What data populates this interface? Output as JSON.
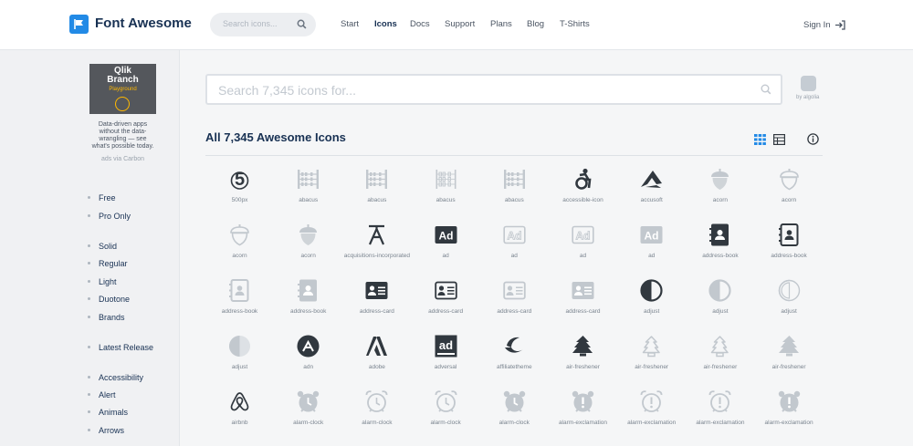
{
  "header": {
    "brand": "Font Awesome",
    "search_placeholder": "Search icons...",
    "nav": [
      {
        "label": "Start",
        "active": false
      },
      {
        "label": "Icons",
        "active": true
      },
      {
        "label": "Docs",
        "active": false
      },
      {
        "label": "Support",
        "active": false
      },
      {
        "label": "Plans",
        "active": false
      },
      {
        "label": "Blog",
        "active": false
      },
      {
        "label": "T-Shirts",
        "active": false
      }
    ],
    "signin": "Sign In"
  },
  "ad": {
    "title_line1": "Qlik",
    "title_line2": "Branch",
    "subtitle": "Playground",
    "text_lines": [
      "Data-driven apps",
      "without the data-",
      "wrangling — see",
      "what's possible today."
    ],
    "via": "ads via Carbon"
  },
  "sidebar": {
    "groups": [
      [
        "Free",
        "Pro Only"
      ],
      [
        "Solid",
        "Regular",
        "Light",
        "Duotone",
        "Brands"
      ],
      [
        "Latest Release"
      ],
      [
        "Accessibility",
        "Alert",
        "Animals",
        "Arrows"
      ]
    ]
  },
  "search": {
    "placeholder": "Search 7,345 icons for...",
    "powered_by": "by algolia"
  },
  "results": {
    "title": "All 7,345 Awesome Icons"
  },
  "colors": {
    "dark": "#31383f",
    "light": "#c2c8ce",
    "accent": "#228ae6"
  },
  "icons": [
    {
      "name": "500px",
      "glyph": "500px",
      "tone": "dark"
    },
    {
      "name": "abacus",
      "glyph": "abacus",
      "tone": "light"
    },
    {
      "name": "abacus",
      "glyph": "abacus",
      "tone": "light"
    },
    {
      "name": "abacus",
      "glyph": "abacus-outline",
      "tone": "light"
    },
    {
      "name": "abacus",
      "glyph": "abacus",
      "tone": "light"
    },
    {
      "name": "accessible-icon",
      "glyph": "accessible",
      "tone": "dark"
    },
    {
      "name": "accusoft",
      "glyph": "accusoft",
      "tone": "dark"
    },
    {
      "name": "acorn",
      "glyph": "acorn",
      "tone": "light"
    },
    {
      "name": "acorn",
      "glyph": "acorn-outline",
      "tone": "light"
    },
    {
      "name": "acorn",
      "glyph": "acorn-outline",
      "tone": "light"
    },
    {
      "name": "acorn",
      "glyph": "acorn",
      "tone": "light"
    },
    {
      "name": "acquisitions-incorporated",
      "glyph": "acq",
      "tone": "dark"
    },
    {
      "name": "ad",
      "glyph": "ad",
      "tone": "dark"
    },
    {
      "name": "ad",
      "glyph": "ad-outline",
      "tone": "light"
    },
    {
      "name": "ad",
      "glyph": "ad-outline",
      "tone": "light"
    },
    {
      "name": "ad",
      "glyph": "ad",
      "tone": "light"
    },
    {
      "name": "address-book",
      "glyph": "book",
      "tone": "dark"
    },
    {
      "name": "address-book",
      "glyph": "book-outline",
      "tone": "dark"
    },
    {
      "name": "address-book",
      "glyph": "book-outline",
      "tone": "light"
    },
    {
      "name": "address-book",
      "glyph": "book",
      "tone": "light"
    },
    {
      "name": "address-card",
      "glyph": "card",
      "tone": "dark"
    },
    {
      "name": "address-card",
      "glyph": "card-outline",
      "tone": "dark"
    },
    {
      "name": "address-card",
      "glyph": "card-outline",
      "tone": "light"
    },
    {
      "name": "address-card",
      "glyph": "card",
      "tone": "light"
    },
    {
      "name": "adjust",
      "glyph": "adjust",
      "tone": "dark"
    },
    {
      "name": "adjust",
      "glyph": "adjust",
      "tone": "light"
    },
    {
      "name": "adjust",
      "glyph": "adjust-outline",
      "tone": "light"
    },
    {
      "name": "adjust",
      "glyph": "adjust-solid",
      "tone": "light"
    },
    {
      "name": "adn",
      "glyph": "adn",
      "tone": "dark"
    },
    {
      "name": "adobe",
      "glyph": "adobe",
      "tone": "dark"
    },
    {
      "name": "adversal",
      "glyph": "adversal",
      "tone": "dark"
    },
    {
      "name": "affiliatetheme",
      "glyph": "affiliate",
      "tone": "dark"
    },
    {
      "name": "air-freshener",
      "glyph": "tree",
      "tone": "dark"
    },
    {
      "name": "air-freshener",
      "glyph": "tree-outline",
      "tone": "light"
    },
    {
      "name": "air-freshener",
      "glyph": "tree-outline",
      "tone": "light"
    },
    {
      "name": "air-freshener",
      "glyph": "tree",
      "tone": "light"
    },
    {
      "name": "airbnb",
      "glyph": "airbnb",
      "tone": "dark"
    },
    {
      "name": "alarm-clock",
      "glyph": "clock",
      "tone": "light"
    },
    {
      "name": "alarm-clock",
      "glyph": "clock-outline",
      "tone": "light"
    },
    {
      "name": "alarm-clock",
      "glyph": "clock-outline",
      "tone": "light"
    },
    {
      "name": "alarm-clock",
      "glyph": "clock",
      "tone": "light"
    },
    {
      "name": "alarm-exclamation",
      "glyph": "clock-excl",
      "tone": "light"
    },
    {
      "name": "alarm-exclamation",
      "glyph": "clock-excl-outline",
      "tone": "light"
    },
    {
      "name": "alarm-exclamation",
      "glyph": "clock-excl-outline",
      "tone": "light"
    },
    {
      "name": "alarm-exclamation",
      "glyph": "clock-excl",
      "tone": "light"
    }
  ]
}
